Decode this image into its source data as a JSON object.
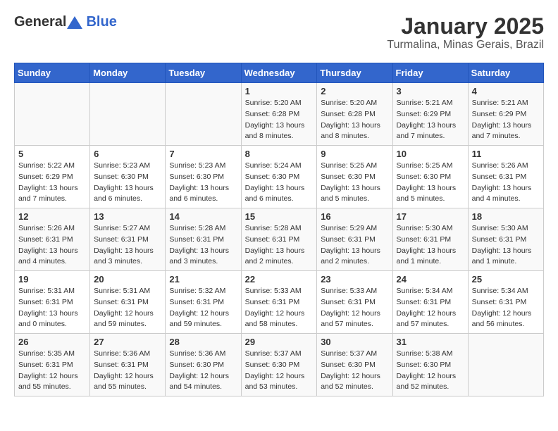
{
  "header": {
    "logo": {
      "text_general": "General",
      "text_blue": "Blue"
    },
    "month": "January 2025",
    "location": "Turmalina, Minas Gerais, Brazil"
  },
  "weekdays": [
    "Sunday",
    "Monday",
    "Tuesday",
    "Wednesday",
    "Thursday",
    "Friday",
    "Saturday"
  ],
  "weeks": [
    [
      {
        "day": "",
        "info": ""
      },
      {
        "day": "",
        "info": ""
      },
      {
        "day": "",
        "info": ""
      },
      {
        "day": "1",
        "info": "Sunrise: 5:20 AM\nSunset: 6:28 PM\nDaylight: 13 hours\nand 8 minutes."
      },
      {
        "day": "2",
        "info": "Sunrise: 5:20 AM\nSunset: 6:28 PM\nDaylight: 13 hours\nand 8 minutes."
      },
      {
        "day": "3",
        "info": "Sunrise: 5:21 AM\nSunset: 6:29 PM\nDaylight: 13 hours\nand 7 minutes."
      },
      {
        "day": "4",
        "info": "Sunrise: 5:21 AM\nSunset: 6:29 PM\nDaylight: 13 hours\nand 7 minutes."
      }
    ],
    [
      {
        "day": "5",
        "info": "Sunrise: 5:22 AM\nSunset: 6:29 PM\nDaylight: 13 hours\nand 7 minutes."
      },
      {
        "day": "6",
        "info": "Sunrise: 5:23 AM\nSunset: 6:30 PM\nDaylight: 13 hours\nand 6 minutes."
      },
      {
        "day": "7",
        "info": "Sunrise: 5:23 AM\nSunset: 6:30 PM\nDaylight: 13 hours\nand 6 minutes."
      },
      {
        "day": "8",
        "info": "Sunrise: 5:24 AM\nSunset: 6:30 PM\nDaylight: 13 hours\nand 6 minutes."
      },
      {
        "day": "9",
        "info": "Sunrise: 5:25 AM\nSunset: 6:30 PM\nDaylight: 13 hours\nand 5 minutes."
      },
      {
        "day": "10",
        "info": "Sunrise: 5:25 AM\nSunset: 6:30 PM\nDaylight: 13 hours\nand 5 minutes."
      },
      {
        "day": "11",
        "info": "Sunrise: 5:26 AM\nSunset: 6:31 PM\nDaylight: 13 hours\nand 4 minutes."
      }
    ],
    [
      {
        "day": "12",
        "info": "Sunrise: 5:26 AM\nSunset: 6:31 PM\nDaylight: 13 hours\nand 4 minutes."
      },
      {
        "day": "13",
        "info": "Sunrise: 5:27 AM\nSunset: 6:31 PM\nDaylight: 13 hours\nand 3 minutes."
      },
      {
        "day": "14",
        "info": "Sunrise: 5:28 AM\nSunset: 6:31 PM\nDaylight: 13 hours\nand 3 minutes."
      },
      {
        "day": "15",
        "info": "Sunrise: 5:28 AM\nSunset: 6:31 PM\nDaylight: 13 hours\nand 2 minutes."
      },
      {
        "day": "16",
        "info": "Sunrise: 5:29 AM\nSunset: 6:31 PM\nDaylight: 13 hours\nand 2 minutes."
      },
      {
        "day": "17",
        "info": "Sunrise: 5:30 AM\nSunset: 6:31 PM\nDaylight: 13 hours\nand 1 minute."
      },
      {
        "day": "18",
        "info": "Sunrise: 5:30 AM\nSunset: 6:31 PM\nDaylight: 13 hours\nand 1 minute."
      }
    ],
    [
      {
        "day": "19",
        "info": "Sunrise: 5:31 AM\nSunset: 6:31 PM\nDaylight: 13 hours\nand 0 minutes."
      },
      {
        "day": "20",
        "info": "Sunrise: 5:31 AM\nSunset: 6:31 PM\nDaylight: 12 hours\nand 59 minutes."
      },
      {
        "day": "21",
        "info": "Sunrise: 5:32 AM\nSunset: 6:31 PM\nDaylight: 12 hours\nand 59 minutes."
      },
      {
        "day": "22",
        "info": "Sunrise: 5:33 AM\nSunset: 6:31 PM\nDaylight: 12 hours\nand 58 minutes."
      },
      {
        "day": "23",
        "info": "Sunrise: 5:33 AM\nSunset: 6:31 PM\nDaylight: 12 hours\nand 57 minutes."
      },
      {
        "day": "24",
        "info": "Sunrise: 5:34 AM\nSunset: 6:31 PM\nDaylight: 12 hours\nand 57 minutes."
      },
      {
        "day": "25",
        "info": "Sunrise: 5:34 AM\nSunset: 6:31 PM\nDaylight: 12 hours\nand 56 minutes."
      }
    ],
    [
      {
        "day": "26",
        "info": "Sunrise: 5:35 AM\nSunset: 6:31 PM\nDaylight: 12 hours\nand 55 minutes."
      },
      {
        "day": "27",
        "info": "Sunrise: 5:36 AM\nSunset: 6:31 PM\nDaylight: 12 hours\nand 55 minutes."
      },
      {
        "day": "28",
        "info": "Sunrise: 5:36 AM\nSunset: 6:30 PM\nDaylight: 12 hours\nand 54 minutes."
      },
      {
        "day": "29",
        "info": "Sunrise: 5:37 AM\nSunset: 6:30 PM\nDaylight: 12 hours\nand 53 minutes."
      },
      {
        "day": "30",
        "info": "Sunrise: 5:37 AM\nSunset: 6:30 PM\nDaylight: 12 hours\nand 52 minutes."
      },
      {
        "day": "31",
        "info": "Sunrise: 5:38 AM\nSunset: 6:30 PM\nDaylight: 12 hours\nand 52 minutes."
      },
      {
        "day": "",
        "info": ""
      }
    ]
  ]
}
